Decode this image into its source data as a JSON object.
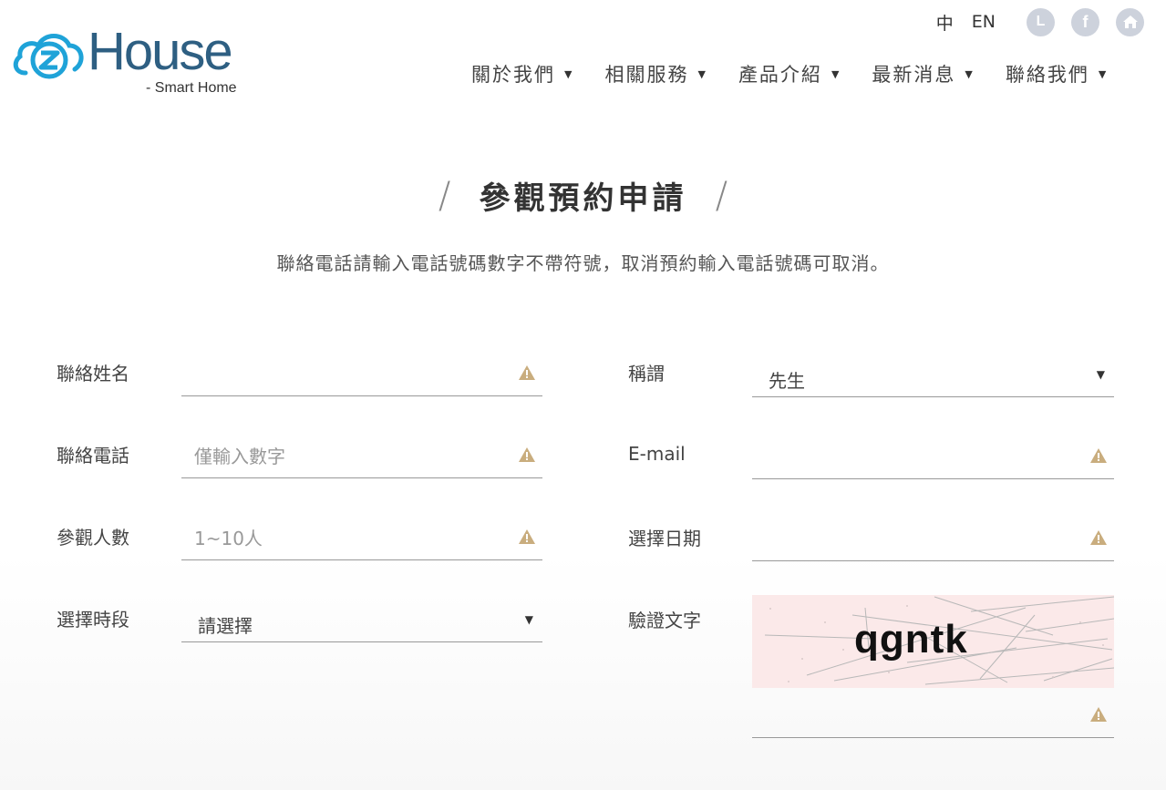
{
  "header": {
    "logo_word": "House",
    "logo_sub": "- Smart  Home",
    "lang_zh": "中",
    "lang_en": "EN",
    "social_icons": [
      "line-icon",
      "facebook-icon",
      "home-icon"
    ],
    "line_glyph": "L",
    "facebook_glyph": "f",
    "nav": [
      {
        "label": "關於我們"
      },
      {
        "label": "相關服務"
      },
      {
        "label": "產品介紹"
      },
      {
        "label": "最新消息"
      },
      {
        "label": "聯絡我們"
      }
    ],
    "caret": "▼"
  },
  "page": {
    "slash": "/",
    "title": "參觀預約申請",
    "subtitle": "聯絡電話請輸入電話號碼數字不帶符號，取消預約輸入電話號碼可取消。"
  },
  "form": {
    "name": {
      "label": "聯絡姓名",
      "value": "",
      "placeholder": ""
    },
    "title_select": {
      "label": "稱謂",
      "value": "先生"
    },
    "phone": {
      "label": "聯絡電話",
      "value": "",
      "placeholder": "僅輸入數字"
    },
    "email": {
      "label": "E-mail",
      "value": "",
      "placeholder": ""
    },
    "people": {
      "label": "參觀人數",
      "value": "",
      "placeholder": "1~10人"
    },
    "date": {
      "label": "選擇日期",
      "value": "",
      "placeholder": ""
    },
    "timeslot": {
      "label": "選擇時段",
      "value": "請選擇"
    },
    "captcha": {
      "label": "驗證文字",
      "image_text": "qgntk",
      "value": "",
      "placeholder": ""
    },
    "select_caret": "▼"
  },
  "colors": {
    "accent": "#2e5f82",
    "logo_cyan": "#1fa3d8",
    "warning_icon": "#c9ad7e",
    "social_icon_bg": "#cdd2dc",
    "captcha_bg": "#fbe9e9"
  }
}
